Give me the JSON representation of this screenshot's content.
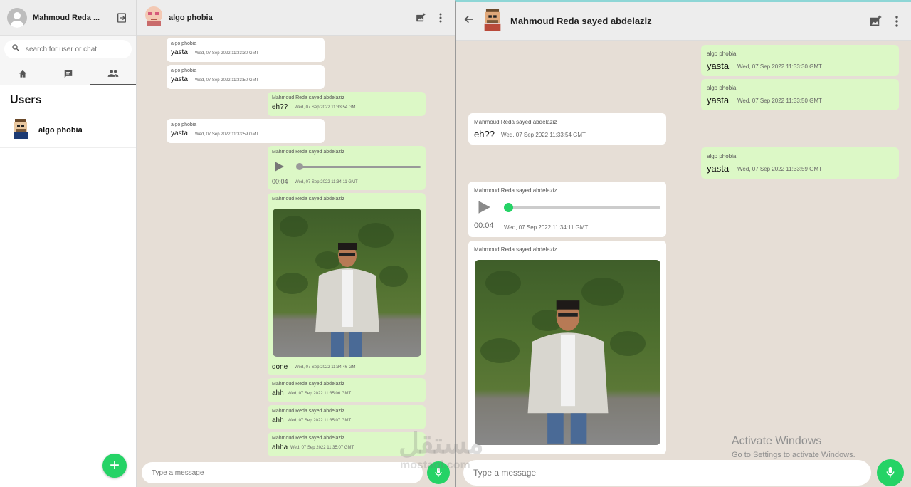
{
  "sidebar": {
    "profile_name": "Mahmoud Reda ...",
    "search_placeholder": "search for user or chat",
    "section_title": "Users",
    "users": [
      {
        "name": "algo phobia"
      }
    ]
  },
  "chat1": {
    "title": "algo phobia",
    "input_placeholder": "Type a message",
    "messages": [
      {
        "sender": "algo phobia",
        "text": "yasta",
        "time": "Wed, 07 Sep 2022 11:33:30 GMT"
      },
      {
        "sender": "algo phobia",
        "text": "yasta",
        "time": "Wed, 07 Sep 2022 11:33:50 GMT"
      },
      {
        "sender": "Mahmoud Reda sayed abdelaziz",
        "text": "eh??",
        "time": "Wed, 07 Sep 2022 11:33:54 GMT"
      },
      {
        "sender": "algo phobia",
        "text": "yasta",
        "time": "Wed, 07 Sep 2022 11:33:59 GMT"
      },
      {
        "sender": "Mahmoud Reda sayed abdelaziz",
        "text": "00:04",
        "time": "Wed, 07 Sep 2022 11:34:11 GMT"
      },
      {
        "sender": "Mahmoud Reda sayed abdelaziz",
        "text": "done",
        "time": "Wed, 07 Sep 2022 11:34:46 GMT"
      },
      {
        "sender": "Mahmoud Reda sayed abdelaziz",
        "text": "ahh",
        "time": "Wed, 07 Sep 2022 11:35:06 GMT"
      },
      {
        "sender": "Mahmoud Reda sayed abdelaziz",
        "text": "ahh",
        "time": "Wed, 07 Sep 2022 11:35:07 GMT"
      },
      {
        "sender": "Mahmoud Reda sayed abdelaziz",
        "text": "ahha",
        "time": "Wed, 07 Sep 2022 11:35:07 GMT"
      }
    ]
  },
  "chat2": {
    "title": "Mahmoud Reda sayed abdelaziz",
    "input_placeholder": "Type a message",
    "messages": [
      {
        "sender": "algo phobia",
        "text": "yasta",
        "time": "Wed, 07 Sep 2022 11:33:30 GMT"
      },
      {
        "sender": "algo phobia",
        "text": "yasta",
        "time": "Wed, 07 Sep 2022 11:33:50 GMT"
      },
      {
        "sender": "Mahmoud Reda sayed abdelaziz",
        "text": "eh??",
        "time": "Wed, 07 Sep 2022 11:33:54 GMT"
      },
      {
        "sender": "algo phobia",
        "text": "yasta",
        "time": "Wed, 07 Sep 2022 11:33:59 GMT"
      },
      {
        "sender": "Mahmoud Reda sayed abdelaziz",
        "text": "00:04",
        "time": "Wed, 07 Sep 2022 11:34:11 GMT"
      },
      {
        "sender": "Mahmoud Reda sayed abdelaziz",
        "text": ""
      }
    ]
  },
  "os_overlay": {
    "activate_title": "Activate Windows",
    "activate_subtitle": "Go to Settings to activate Windows.",
    "watermark_main": "مستقل",
    "watermark_sub": "mostaql.com"
  },
  "colors": {
    "accent": "#25d366",
    "outgoing": "#dcf8c6",
    "incoming": "#ffffff",
    "background": "#e6ded6"
  }
}
